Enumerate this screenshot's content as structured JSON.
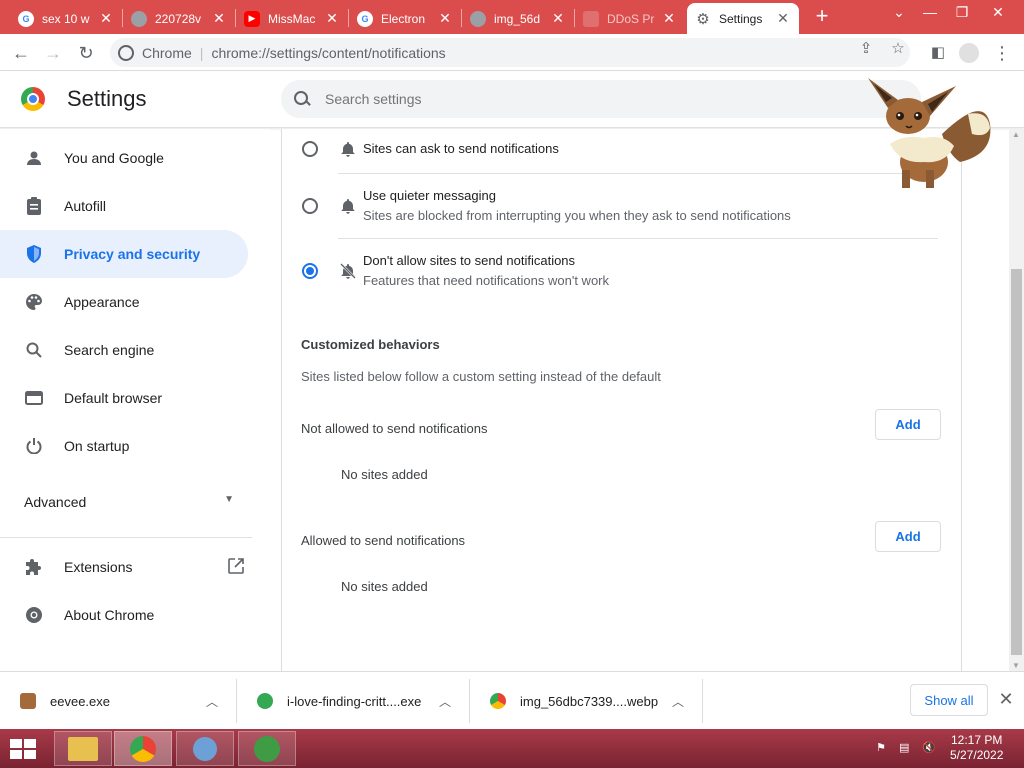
{
  "tabs": [
    {
      "title": "sex 10 w",
      "favicon": "google"
    },
    {
      "title": "220728v",
      "favicon": "globe"
    },
    {
      "title": "MissMac",
      "favicon": "youtube"
    },
    {
      "title": "Electron",
      "favicon": "google"
    },
    {
      "title": "img_56d",
      "favicon": "globe"
    },
    {
      "title": "DDoS Pr",
      "favicon": "blank"
    },
    {
      "title": "Settings",
      "favicon": "gear",
      "active": true
    }
  ],
  "omnibox": {
    "site_label": "Chrome",
    "url": "chrome://settings/content/notifications"
  },
  "header": {
    "title": "Settings",
    "search_placeholder": "Search settings"
  },
  "sidebar": {
    "items": [
      {
        "label": "You and Google",
        "icon": "person-icon"
      },
      {
        "label": "Autofill",
        "icon": "clipboard-icon"
      },
      {
        "label": "Privacy and security",
        "icon": "shield-icon",
        "selected": true
      },
      {
        "label": "Appearance",
        "icon": "palette-icon"
      },
      {
        "label": "Search engine",
        "icon": "search-icon"
      },
      {
        "label": "Default browser",
        "icon": "browser-icon"
      },
      {
        "label": "On startup",
        "icon": "power-icon"
      }
    ],
    "advanced_label": "Advanced",
    "extensions_label": "Extensions",
    "about_label": "About Chrome"
  },
  "notifications": {
    "options": [
      {
        "title": "Sites can ask to send notifications",
        "subtitle": "",
        "icon": "bell-icon",
        "checked": false
      },
      {
        "title": "Use quieter messaging",
        "subtitle": "Sites are blocked from interrupting you when they ask to send notifications",
        "icon": "bell-icon",
        "checked": false
      },
      {
        "title": "Don't allow sites to send notifications",
        "subtitle": "Features that need notifications won't work",
        "icon": "bell-off-icon",
        "checked": true
      }
    ],
    "custom_title": "Customized behaviors",
    "custom_desc": "Sites listed below follow a custom setting instead of the default",
    "not_allowed_label": "Not allowed to send notifications",
    "allowed_label": "Allowed to send notifications",
    "add_label": "Add",
    "no_sites": "No sites added"
  },
  "downloads": {
    "items": [
      {
        "name": "eevee.exe",
        "icon": "eevee-file-icon"
      },
      {
        "name": "i-love-finding-critt....exe",
        "icon": "green-play-icon"
      },
      {
        "name": "img_56dbc7339....webp",
        "icon": "chrome-file-icon"
      }
    ],
    "show_all": "Show all"
  },
  "taskbar": {
    "time": "12:17 PM",
    "date": "5/27/2022"
  },
  "colors": {
    "tabstrip": "#db4d4d",
    "accent": "#1a73e8",
    "selected_bg": "#e8f0fe"
  }
}
